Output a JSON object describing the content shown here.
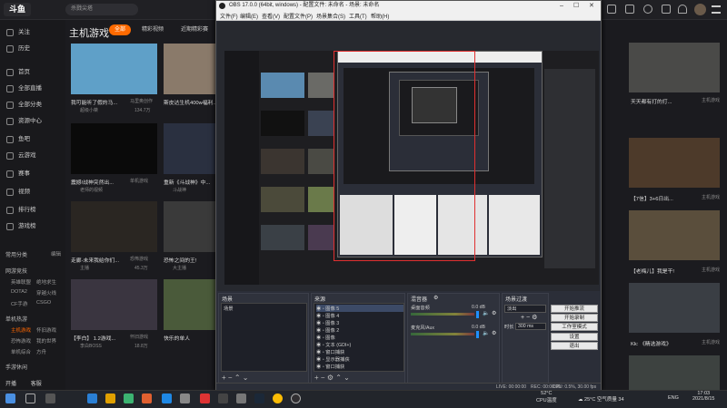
{
  "site": {
    "search_text": "杀戮尖塔",
    "category_title": "主机游戏",
    "filters": [
      "全部",
      "精彩视频",
      "近期精彩赛"
    ],
    "sidebar": {
      "items": [
        {
          "label": "关注",
          "icon": "heart-icon"
        },
        {
          "label": "历史",
          "icon": "clock-icon"
        },
        {
          "label": "首页",
          "icon": "home-icon"
        },
        {
          "label": "全部直播",
          "icon": "tv-icon"
        },
        {
          "label": "全部分类",
          "icon": "grid-icon"
        },
        {
          "label": "资源中心",
          "icon": "box-icon"
        },
        {
          "label": "鱼吧",
          "icon": "fish-icon"
        },
        {
          "label": "云游戏",
          "icon": "cloud-icon"
        },
        {
          "label": "赛事",
          "icon": "trophy-icon"
        },
        {
          "label": "视频",
          "icon": "video-icon"
        },
        {
          "label": "排行榜",
          "icon": "chart-icon"
        },
        {
          "label": "游戏榜",
          "icon": "gamepad-icon"
        }
      ],
      "groups": [
        {
          "title": "常用分类",
          "action": "编辑"
        },
        {
          "title": "网游竞技"
        },
        {
          "title": "单机热游"
        },
        {
          "title": "手游休闲"
        }
      ],
      "subitems": [
        "英雄联盟",
        "绝地求生",
        "DOTA2",
        "穿越火线",
        "CF手游",
        "CSGO",
        "主机游戏",
        "怀旧游戏",
        "恐怖游戏",
        "我的世界",
        "单机综合",
        "方舟"
      ],
      "bottom": [
        "开播",
        "客服"
      ]
    },
    "cards": [
      {
        "title": "我可能听了假的马...",
        "author": "超级小桀",
        "views": "134.7万",
        "extra": "马里奥创作"
      },
      {
        "title": "斯皮达生机400w福利...",
        "author": "",
        "views": "",
        "extra": ""
      },
      {
        "title": "震撼!战神突然出...",
        "author": "老师的视频",
        "views": "",
        "extra": "单机游戏"
      },
      {
        "title": "重新《斗战神》中...",
        "author": "斗战神",
        "views": "",
        "extra": ""
      },
      {
        "title": "走廊-未来我给你们...",
        "author": "主播",
        "views": "45.3万",
        "extra": "恐怖游戏"
      },
      {
        "title": "恐怖之间的王!",
        "author": "大主播",
        "views": "",
        "extra": ""
      },
      {
        "title": "【李白】 1.2游戏...",
        "author": "李白BOSS",
        "views": "18.8万",
        "extra": "怀旧游戏"
      },
      {
        "title": "快乐的单人",
        "author": "",
        "views": "",
        "extra": ""
      }
    ],
    "right_cards": [
      {
        "title": "天天都有打的打...",
        "meta": "主机游戏"
      },
      {
        "title": "【7信】3+6日出...",
        "meta": "主机游戏"
      },
      {
        "title": "【老梅儿】我是干!",
        "meta": "主机游戏"
      },
      {
        "title": "Kk: 《精选游戏》",
        "meta": "主机游戏"
      }
    ]
  },
  "obs": {
    "title": "OBS 17.0.0 (64bit, windows) - 配置文件: 未命名 - 场景: 未命名",
    "menu": [
      "文件(F)",
      "编辑(E)",
      "查看(V)",
      "配置文件(P)",
      "场景集合(S)",
      "工具(T)",
      "帮助(H)"
    ],
    "panels": {
      "scenes": {
        "header": "场景",
        "items": [
          "场景"
        ]
      },
      "sources": {
        "header": "来源",
        "items": [
          "图像 5",
          "图像 4",
          "图像 3",
          "图像 2",
          "图像",
          "文本 (GDI+)",
          "窗口捕获",
          "显示器捕获",
          "窗口捕获"
        ]
      },
      "mixer": {
        "header": "混音器",
        "tracks": [
          {
            "name": "桌面音频",
            "db": "0.0 dB"
          },
          {
            "name": "麦克风/Aux",
            "db": "0.0 dB"
          }
        ]
      },
      "transitions": {
        "header": "场景过渡",
        "type": "淡出",
        "duration_label": "时长",
        "duration_value": "300 ms"
      },
      "controls": [
        "开始推流",
        "开始录制",
        "工作室模式",
        "设置",
        "退出"
      ]
    },
    "status": {
      "live": "LIVE: 00:00:00",
      "rec": "REC: 00:00:00",
      "cpu": "CPU: 0.5%, 30.00 fps"
    }
  },
  "taskbar": {
    "weather_temp": "25°C",
    "weather_text": "空气质量 34",
    "cpu_temp": "52°C",
    "cpu_label": "CPU温度",
    "lang": "ENG",
    "time": "17:03",
    "date": "2021/8/15"
  },
  "colors": {
    "accent": "#ff6a00",
    "obs_bg": "#2b2e38",
    "site_bg": "#1b1b1f"
  }
}
